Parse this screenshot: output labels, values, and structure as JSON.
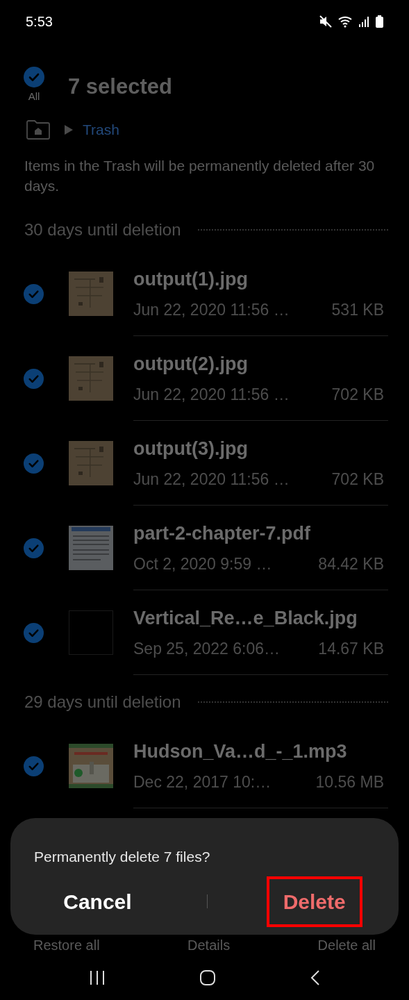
{
  "status_bar": {
    "time": "5:53"
  },
  "header": {
    "all_checked": true,
    "all_label": "All",
    "title": "7 selected"
  },
  "breadcrumb": {
    "current": "Trash"
  },
  "notice": "Items in the Trash will be permanently deleted after 30 days.",
  "groups": [
    {
      "title": "30 days until deletion",
      "files": [
        {
          "name": "output(1).jpg",
          "date": "Jun 22, 2020 11:56 …",
          "size": "531 KB",
          "checked": true,
          "kind": "picture"
        },
        {
          "name": "output(2).jpg",
          "date": "Jun 22, 2020 11:56 …",
          "size": "702 KB",
          "checked": true,
          "kind": "picture"
        },
        {
          "name": "output(3).jpg",
          "date": "Jun 22, 2020 11:56 …",
          "size": "702 KB",
          "checked": true,
          "kind": "picture"
        },
        {
          "name": "part-2-chapter-7.pdf",
          "date": "Oct 2, 2020 9:59 …",
          "size": "84.42 KB",
          "checked": true,
          "kind": "picture"
        },
        {
          "name": "Vertical_Re…e_Black.jpg",
          "date": "Sep 25, 2022 6:06…",
          "size": "14.67 KB",
          "checked": true,
          "kind": "picture"
        }
      ]
    },
    {
      "title": "29 days until deletion",
      "files": [
        {
          "name": "Hudson_Va…d_-_1.mp3",
          "date": "Dec 22, 2017 10:…",
          "size": "10.56 MB",
          "checked": true,
          "kind": "picture"
        }
      ]
    }
  ],
  "bottom_actions": [
    "Restore all",
    "Details",
    "Delete all"
  ],
  "dialog": {
    "message": "Permanently delete 7 files?",
    "buttons": [
      {
        "label": "Cancel",
        "kind": "cancel",
        "highlighted": false
      },
      {
        "label": "Delete",
        "kind": "destructive",
        "highlighted": true
      }
    ]
  }
}
